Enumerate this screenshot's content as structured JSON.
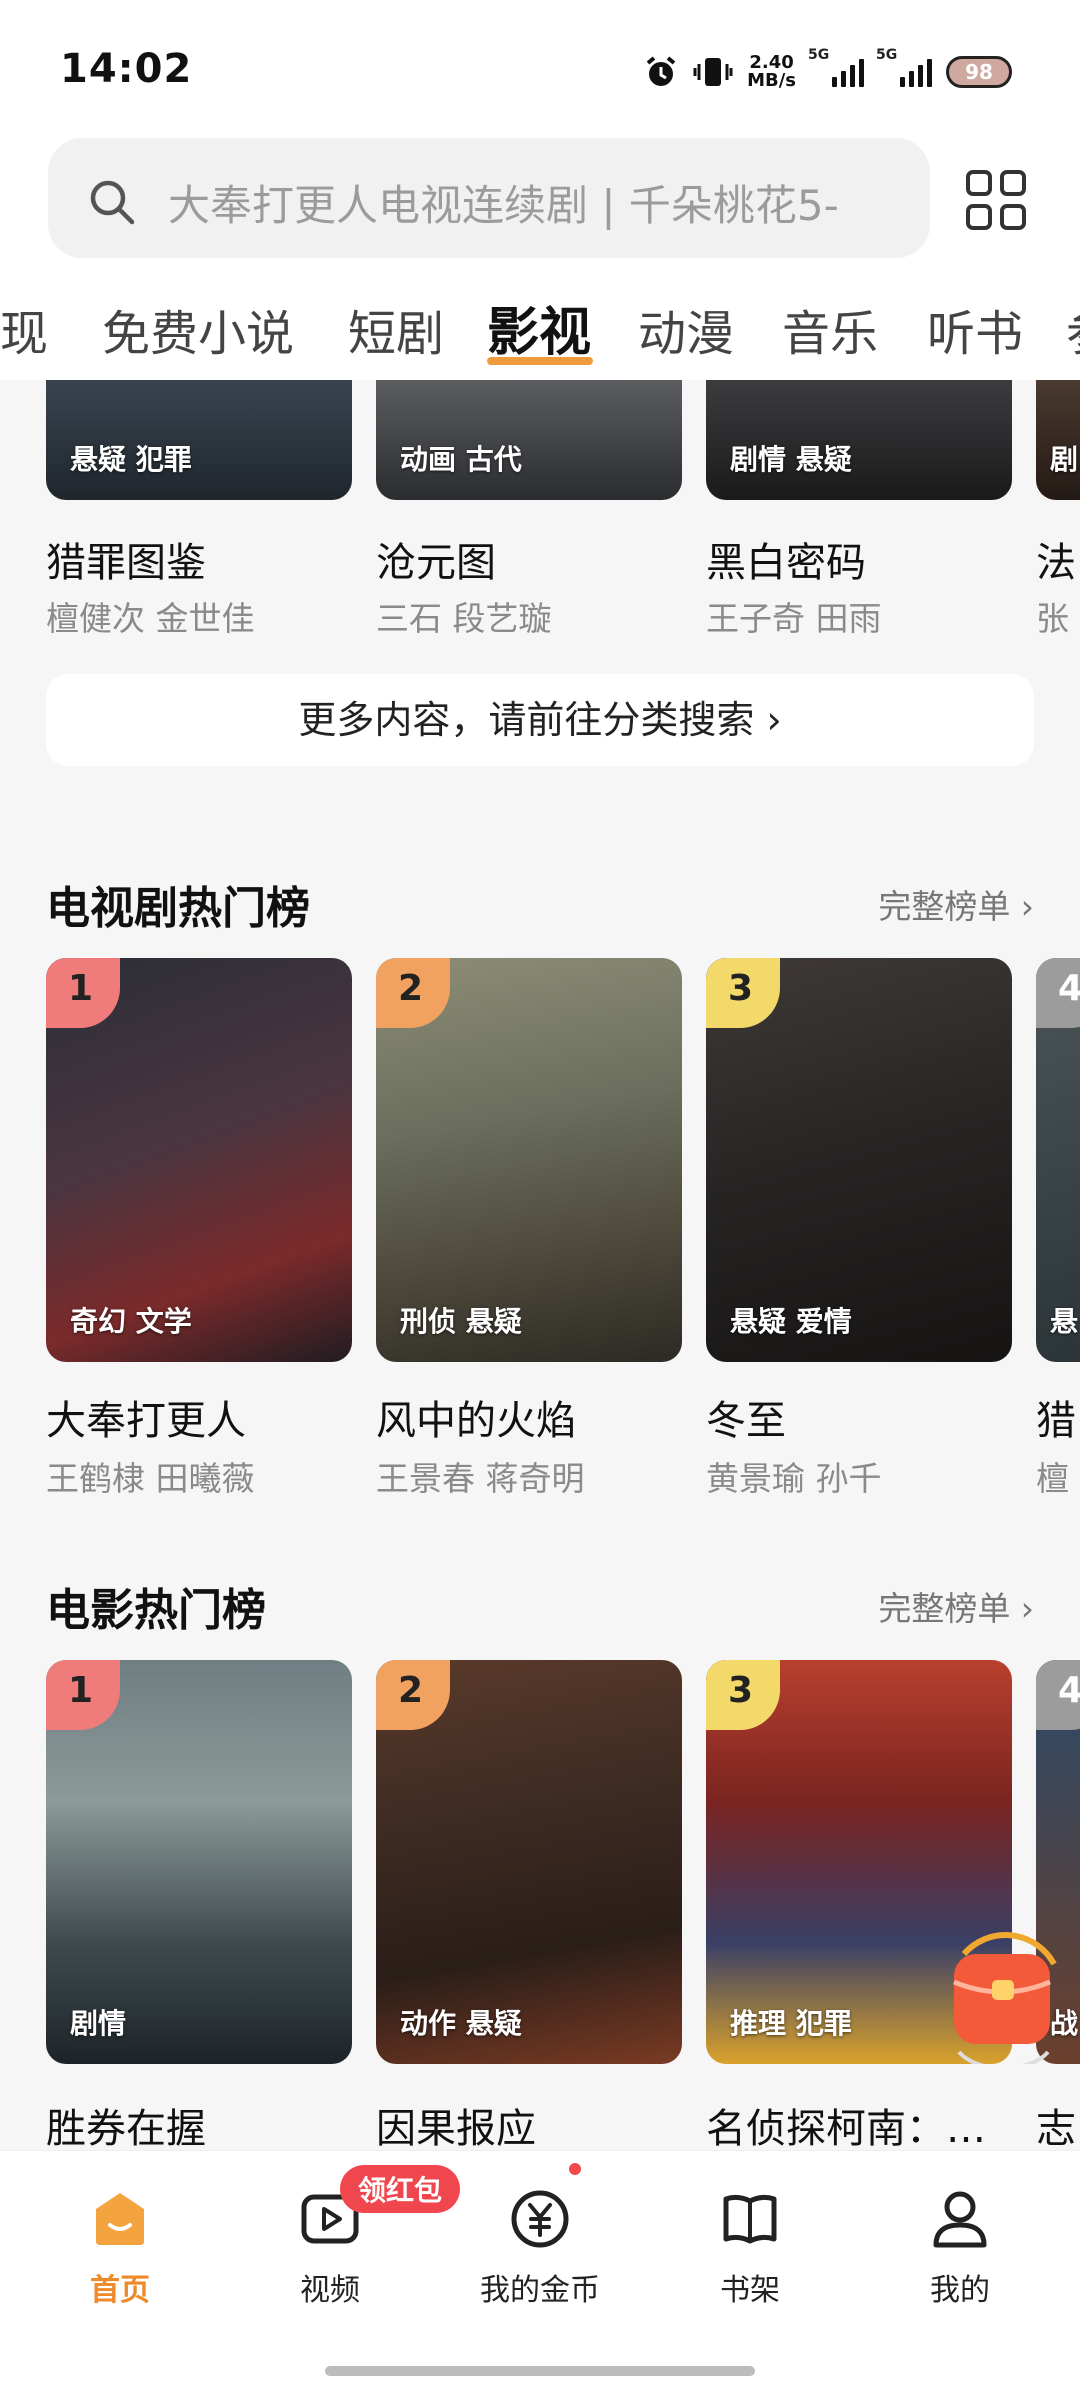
{
  "status_bar": {
    "time": "14:02",
    "net_speed": "2.40",
    "net_speed_unit": "MB/s",
    "sim1": "5G",
    "sim2": "5G",
    "battery": "98"
  },
  "search": {
    "placeholder": "大奉打更人电视连续剧 | 千朵桃花5-"
  },
  "tabs": [
    {
      "label": "现"
    },
    {
      "label": "免费小说"
    },
    {
      "label": "短剧"
    },
    {
      "label": "影视",
      "active": true
    },
    {
      "label": "动漫"
    },
    {
      "label": "音乐"
    },
    {
      "label": "听书"
    },
    {
      "label": "参"
    }
  ],
  "top_row": [
    {
      "tags": "悬疑 犯罪",
      "title": "猎罪图鉴",
      "cast": "檀健次 金世佳"
    },
    {
      "tags": "动画 古代",
      "title": "沧元图",
      "cast": "三石 段艺璇"
    },
    {
      "tags": "剧情 悬疑",
      "title": "黑白密码",
      "cast": "王子奇 田雨"
    },
    {
      "tags": "剧",
      "title": "法",
      "cast": "张"
    }
  ],
  "more_button": "更多内容，请前往分类搜索 ›",
  "tv_section": {
    "title": "电视剧热门榜",
    "link": "完整榜单 ›",
    "items": [
      {
        "rank": "1",
        "tags": "奇幻 文学",
        "title": "大奉打更人",
        "cast": "王鹤棣 田曦薇"
      },
      {
        "rank": "2",
        "tags": "刑侦 悬疑",
        "title": "风中的火焰",
        "cast": "王景春 蒋奇明"
      },
      {
        "rank": "3",
        "tags": "悬疑 爱情",
        "title": "冬至",
        "cast": "黄景瑜 孙千"
      },
      {
        "rank": "4",
        "tags": "悬",
        "title": "猎",
        "cast": "檀"
      }
    ]
  },
  "movie_section": {
    "title": "电影热门榜",
    "link": "完整榜单 ›",
    "items": [
      {
        "rank": "1",
        "tags": "剧情",
        "title": "胜券在握"
      },
      {
        "rank": "2",
        "tags": "动作 悬疑",
        "title": "因果报应"
      },
      {
        "rank": "3",
        "tags": "推理 犯罪",
        "title": "名侦探柯南：…"
      },
      {
        "rank": "4",
        "tags": "战",
        "title": "志"
      }
    ]
  },
  "bottom_nav": {
    "items": [
      {
        "label": "首页",
        "active": true
      },
      {
        "label": "视频"
      },
      {
        "label": "我的金币"
      },
      {
        "label": "书架"
      },
      {
        "label": "我的"
      }
    ],
    "video_badge": "领红包"
  },
  "colors": {
    "accent": "#f09a3e",
    "background": "#f6f6f6",
    "rank1": "#f07b7b",
    "rank2": "#f1a261",
    "rank3": "#f3d96a",
    "badge": "#f0474f"
  }
}
